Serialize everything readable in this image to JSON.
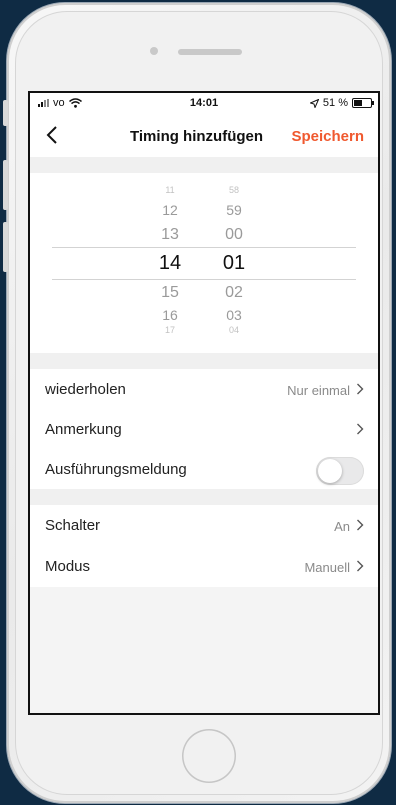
{
  "status_bar": {
    "carrier": "vo",
    "time": "14:01",
    "battery": "51 %"
  },
  "header": {
    "back_icon": "chevron-left-icon",
    "title": "Timing hinzufügen",
    "save_label": "Speichern",
    "accent_color": "#f0592f"
  },
  "picker": {
    "hours": [
      "11",
      "12",
      "13",
      "14",
      "15",
      "16",
      "17"
    ],
    "minutes": [
      "58",
      "59",
      "00",
      "01",
      "02",
      "03",
      "04"
    ],
    "selected_hour": "14",
    "selected_minute": "01"
  },
  "settings": {
    "repeat_label": "wiederholen",
    "repeat_value": "Nur einmal",
    "note_label": "Anmerkung",
    "notify_label": "Ausführungsmeldung",
    "notify_on": false
  },
  "actions": {
    "switch_label": "Schalter",
    "switch_value": "An",
    "mode_label": "Modus",
    "mode_value": "Manuell"
  }
}
